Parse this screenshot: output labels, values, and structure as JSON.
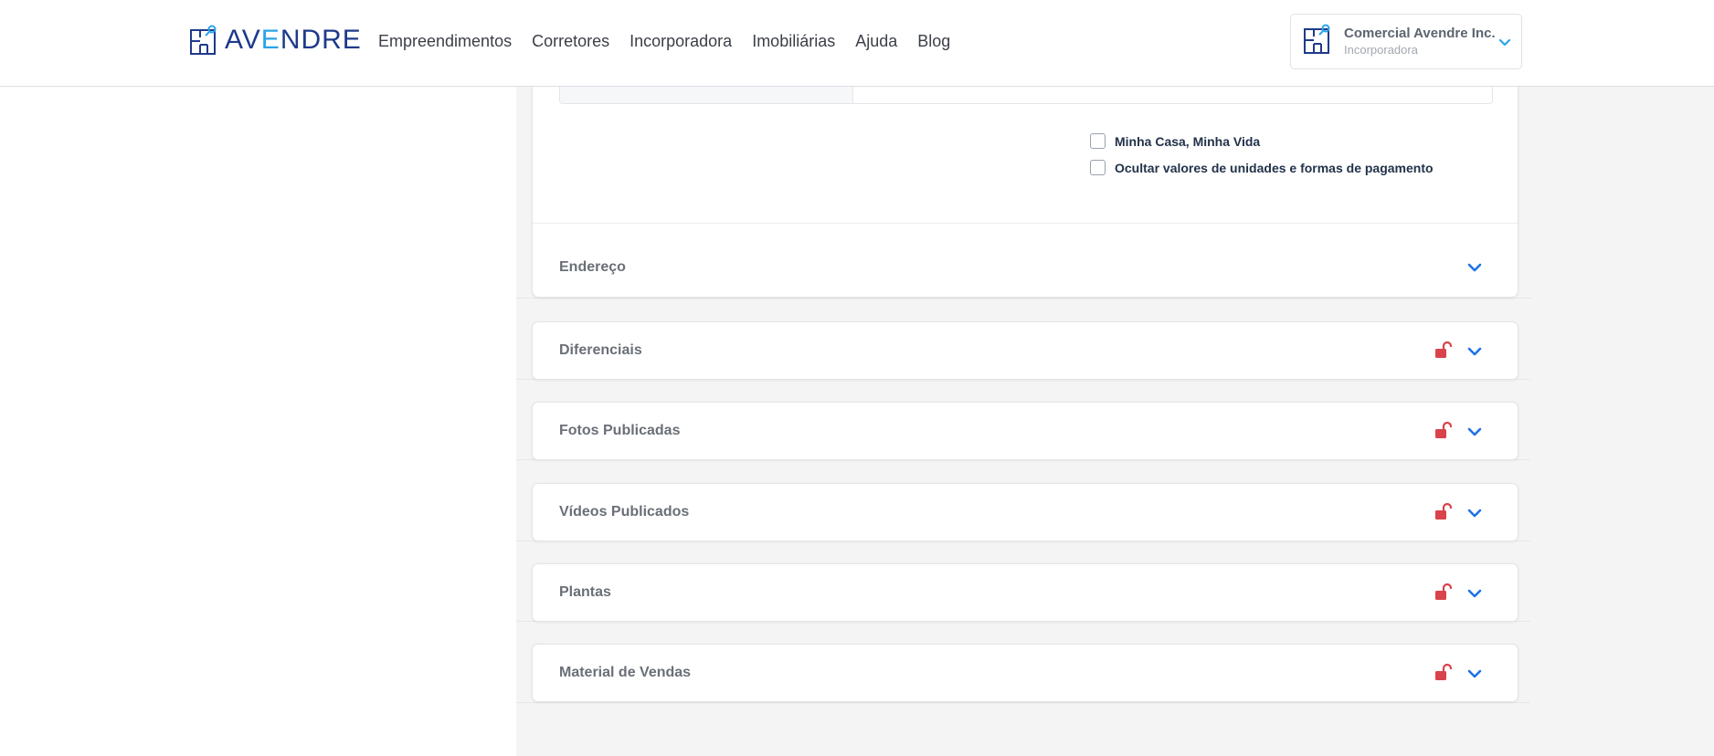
{
  "header": {
    "logo": {
      "prefix": "AV",
      "accent": "E",
      "suffix": "NDRE",
      "brand_color": "#1f3a8a",
      "accent_color": "#2aa3e8",
      "icon": "building-plan-logo"
    },
    "nav": [
      "Empreendimentos",
      "Corretores",
      "Incorporadora",
      "Imobiliárias",
      "Ajuda",
      "Blog"
    ],
    "account": {
      "name": "Comercial Avendre Inc.",
      "role": "Incorporadora",
      "icon": "building-plan-logo",
      "dropdown_icon": "chevron-down-icon"
    }
  },
  "form": {
    "checkboxes": [
      {
        "label": "Minha Casa, Minha Vida",
        "checked": false
      },
      {
        "label": "Ocultar valores de unidades e formas de pagamento",
        "checked": false
      }
    ]
  },
  "sections": [
    {
      "title": "Endereço",
      "locked": false,
      "icon": "chevron-down-icon"
    },
    {
      "title": "Diferenciais",
      "locked": true,
      "icon": "unlock-icon"
    },
    {
      "title": "Fotos Publicadas",
      "locked": true,
      "icon": "unlock-icon"
    },
    {
      "title": "Vídeos Publicados",
      "locked": true,
      "icon": "unlock-icon"
    },
    {
      "title": "Plantas",
      "locked": true,
      "icon": "unlock-icon"
    },
    {
      "title": "Material de Vendas",
      "locked": true,
      "icon": "unlock-icon"
    }
  ],
  "colors": {
    "lock": "#d9434b",
    "chevron": "#1d72e8",
    "background": "#f4f4f4"
  }
}
